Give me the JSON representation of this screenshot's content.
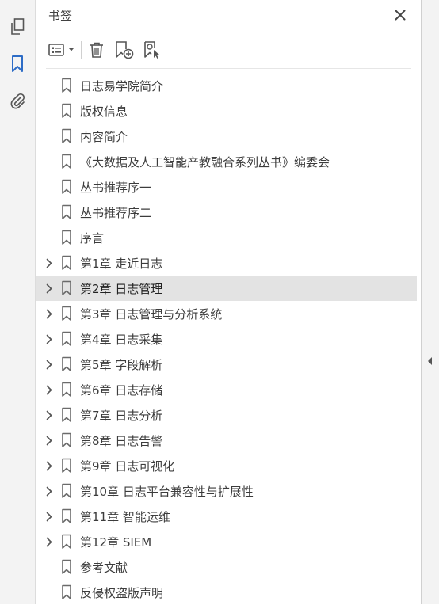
{
  "left_toolbar": {
    "icons": [
      "pages-icon",
      "bookmark-icon",
      "attachment-icon"
    ],
    "active": "bookmark-icon",
    "active_color": "#2d6cc6"
  },
  "panel": {
    "title": "书签",
    "close_icon": "close-icon"
  },
  "toolbar": {
    "icons": [
      "options-menu-icon",
      "delete-bookmark-icon",
      "new-bookmark-icon",
      "find-bookmark-icon"
    ]
  },
  "bookmarks": [
    {
      "label": "日志易学院简介",
      "expandable": false,
      "selected": false
    },
    {
      "label": "版权信息",
      "expandable": false,
      "selected": false
    },
    {
      "label": "内容简介",
      "expandable": false,
      "selected": false
    },
    {
      "label": "《大数据及人工智能产教融合系列丛书》编委会",
      "expandable": false,
      "selected": false
    },
    {
      "label": "丛书推荐序一",
      "expandable": false,
      "selected": false
    },
    {
      "label": "丛书推荐序二",
      "expandable": false,
      "selected": false
    },
    {
      "label": "序言",
      "expandable": false,
      "selected": false
    },
    {
      "label": "第1章 走近日志",
      "expandable": true,
      "selected": false
    },
    {
      "label": "第2章 日志管理",
      "expandable": true,
      "selected": true
    },
    {
      "label": "第3章 日志管理与分析系统",
      "expandable": true,
      "selected": false
    },
    {
      "label": "第4章 日志采集",
      "expandable": true,
      "selected": false
    },
    {
      "label": "第5章 字段解析",
      "expandable": true,
      "selected": false
    },
    {
      "label": "第6章 日志存储",
      "expandable": true,
      "selected": false
    },
    {
      "label": "第7章 日志分析",
      "expandable": true,
      "selected": false
    },
    {
      "label": "第8章 日志告警",
      "expandable": true,
      "selected": false
    },
    {
      "label": "第9章 日志可视化",
      "expandable": true,
      "selected": false
    },
    {
      "label": "第10章 日志平台兼容性与扩展性",
      "expandable": true,
      "selected": false
    },
    {
      "label": "第11章 智能运维",
      "expandable": true,
      "selected": false
    },
    {
      "label": "第12章 SIEM",
      "expandable": true,
      "selected": false
    },
    {
      "label": "参考文献",
      "expandable": false,
      "selected": false
    },
    {
      "label": "反侵权盗版声明",
      "expandable": false,
      "selected": false
    }
  ],
  "right_strip": {
    "collapse_icon": "collapse-left-icon"
  }
}
